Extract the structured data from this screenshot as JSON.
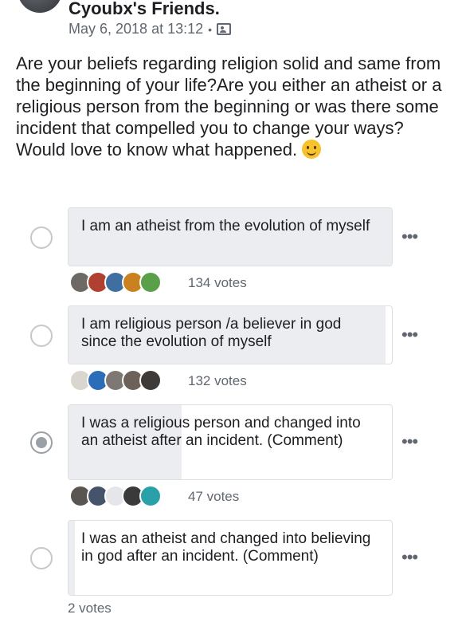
{
  "group": {
    "name": "Cyoubx's Friends.",
    "timestamp": "May 6, 2018 at 13:12",
    "separator": "•"
  },
  "post": {
    "lines": [
      "Are your beliefs regarding religion solid and same from the beginning of your life?Are you either an atheist or a religious person from the beginning or was there some incident that compelled you to change your ways?",
      "Would love to know what happened."
    ]
  },
  "poll": {
    "options": [
      {
        "text": "I am an atheist from the evolution of myself",
        "votes": "134 votes",
        "fill_fraction": 1.0,
        "selected": false,
        "voter_colors": [
          "#6d6a66",
          "#b0402f",
          "#3f6fa1",
          "#c9821f",
          "#5aa04a"
        ]
      },
      {
        "text": "I am religious person /a believer in god since the evolution of myself",
        "votes": "132 votes",
        "fill_fraction": 0.98,
        "selected": false,
        "voter_colors": [
          "#d9d6cf",
          "#2b6db8",
          "#7d7873",
          "#6c6259",
          "#3e3a37"
        ]
      },
      {
        "text": "I was a religious person and changed into an atheist after an incident. (Comment)",
        "votes": "47 votes",
        "fill_fraction": 0.35,
        "selected": true,
        "voter_colors": [
          "#5a5550",
          "#46546b",
          "#e4e6ea",
          "#3a3a3a",
          "#2aa1a8"
        ]
      },
      {
        "text": "I was an atheist and changed into believing in god after an incident. (Comment)",
        "votes": "2 votes",
        "fill_fraction": 0.02,
        "selected": false,
        "voter_colors": []
      }
    ]
  },
  "icons": {
    "more": "more-horizontal-icon",
    "audience": "group-audience-icon",
    "emoji": "smiling-face-emoji"
  }
}
